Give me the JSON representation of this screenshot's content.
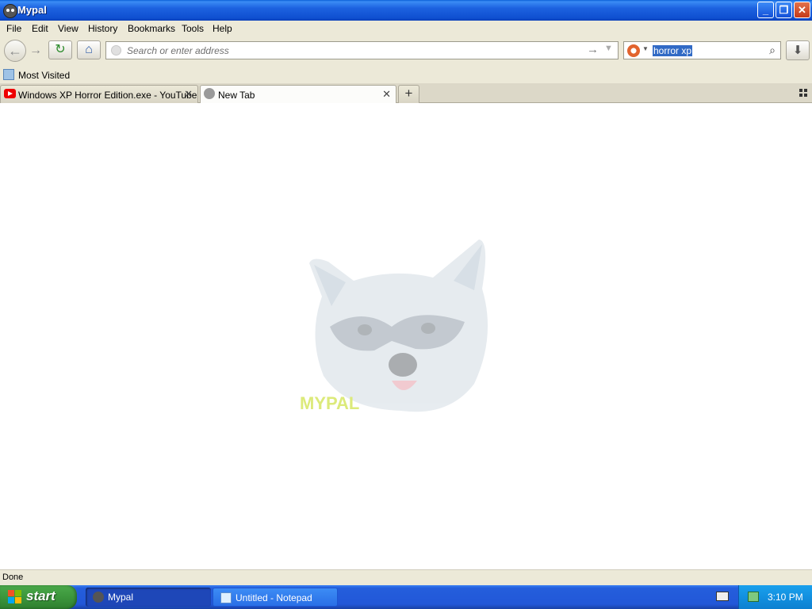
{
  "window": {
    "title": "Mypal"
  },
  "menu": [
    "File",
    "Edit",
    "View",
    "History",
    "Bookmarks",
    "Tools",
    "Help"
  ],
  "nav": {
    "address_placeholder": "Search or enter address",
    "search_value": "horror xp"
  },
  "bookmarks": {
    "most_visited": "Most Visited"
  },
  "tabs": [
    {
      "title": "Windows XP Horror Edition.exe - YouTube",
      "active": false
    },
    {
      "title": "New Tab",
      "active": true
    }
  ],
  "content": {
    "logo_text": "MYPAL"
  },
  "status": {
    "text": "Done"
  },
  "taskbar": {
    "start_label": "start",
    "tasks": [
      {
        "label": "Mypal",
        "active": true
      },
      {
        "label": "Untitled - Notepad",
        "active": false
      }
    ],
    "clock": "3:10 PM"
  },
  "colors": {
    "title_bar": "#1c62e0",
    "chrome": "#ece9d8",
    "taskbar": "#245edc",
    "start_button": "#3c963c",
    "tray": "#1290e0",
    "selection": "#316ac5",
    "youtube_red": "#e00000"
  }
}
